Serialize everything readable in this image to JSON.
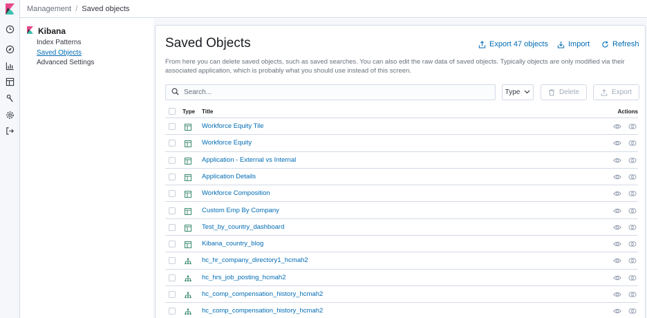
{
  "breadcrumbs": [
    "Management",
    "Saved objects"
  ],
  "sidebar": {
    "app_name": "Kibana",
    "items": [
      {
        "label": "Index Patterns",
        "active": false
      },
      {
        "label": "Saved Objects",
        "active": true
      },
      {
        "label": "Advanced Settings",
        "active": false
      }
    ]
  },
  "rail_icons": [
    "clock-icon",
    "compass-icon",
    "bar-chart-icon",
    "dashboard-icon",
    "wrench-icon",
    "gear-icon",
    "logout-icon"
  ],
  "panel": {
    "title": "Saved Objects",
    "export_label": "Export 47 objects",
    "import_label": "Import",
    "refresh_label": "Refresh",
    "description": "From here you can delete saved objects, such as saved searches. You can also edit the raw data of saved objects. Typically objects are only modified via their associated application, which is probably what you should use instead of this screen."
  },
  "search": {
    "placeholder": "Search..."
  },
  "filters": {
    "type_label": "Type",
    "delete_label": "Delete",
    "export_label": "Export"
  },
  "table": {
    "headers": {
      "type": "Type",
      "title": "Title",
      "actions": "Actions"
    },
    "rows": [
      {
        "type": "dashboard",
        "title": "Workforce Equity Tile"
      },
      {
        "type": "dashboard",
        "title": "Workforce Equity"
      },
      {
        "type": "dashboard",
        "title": "Application - External vs Internal"
      },
      {
        "type": "dashboard",
        "title": "Application Details"
      },
      {
        "type": "dashboard",
        "title": "Workforce Composition"
      },
      {
        "type": "dashboard",
        "title": "Custom Emp By Company"
      },
      {
        "type": "dashboard",
        "title": "Test_by_country_dashboard"
      },
      {
        "type": "dashboard",
        "title": "Kibana_country_blog"
      },
      {
        "type": "index-pattern",
        "title": "hc_hr_company_directory1_hcmah2"
      },
      {
        "type": "index-pattern",
        "title": "hc_hrs_job_posting_hcmah2"
      },
      {
        "type": "index-pattern",
        "title": "hc_comp_compensation_history_hcmah2"
      },
      {
        "type": "index-pattern",
        "title": "hc_comp_compensation_history_hcmah2"
      }
    ]
  },
  "colors": {
    "link": "#006bb4",
    "border": "#d3dae6",
    "kibana_pink": "#e8488b",
    "kibana_teal": "#3ebeb0",
    "dashboard_icon": "#3b8a6e"
  }
}
